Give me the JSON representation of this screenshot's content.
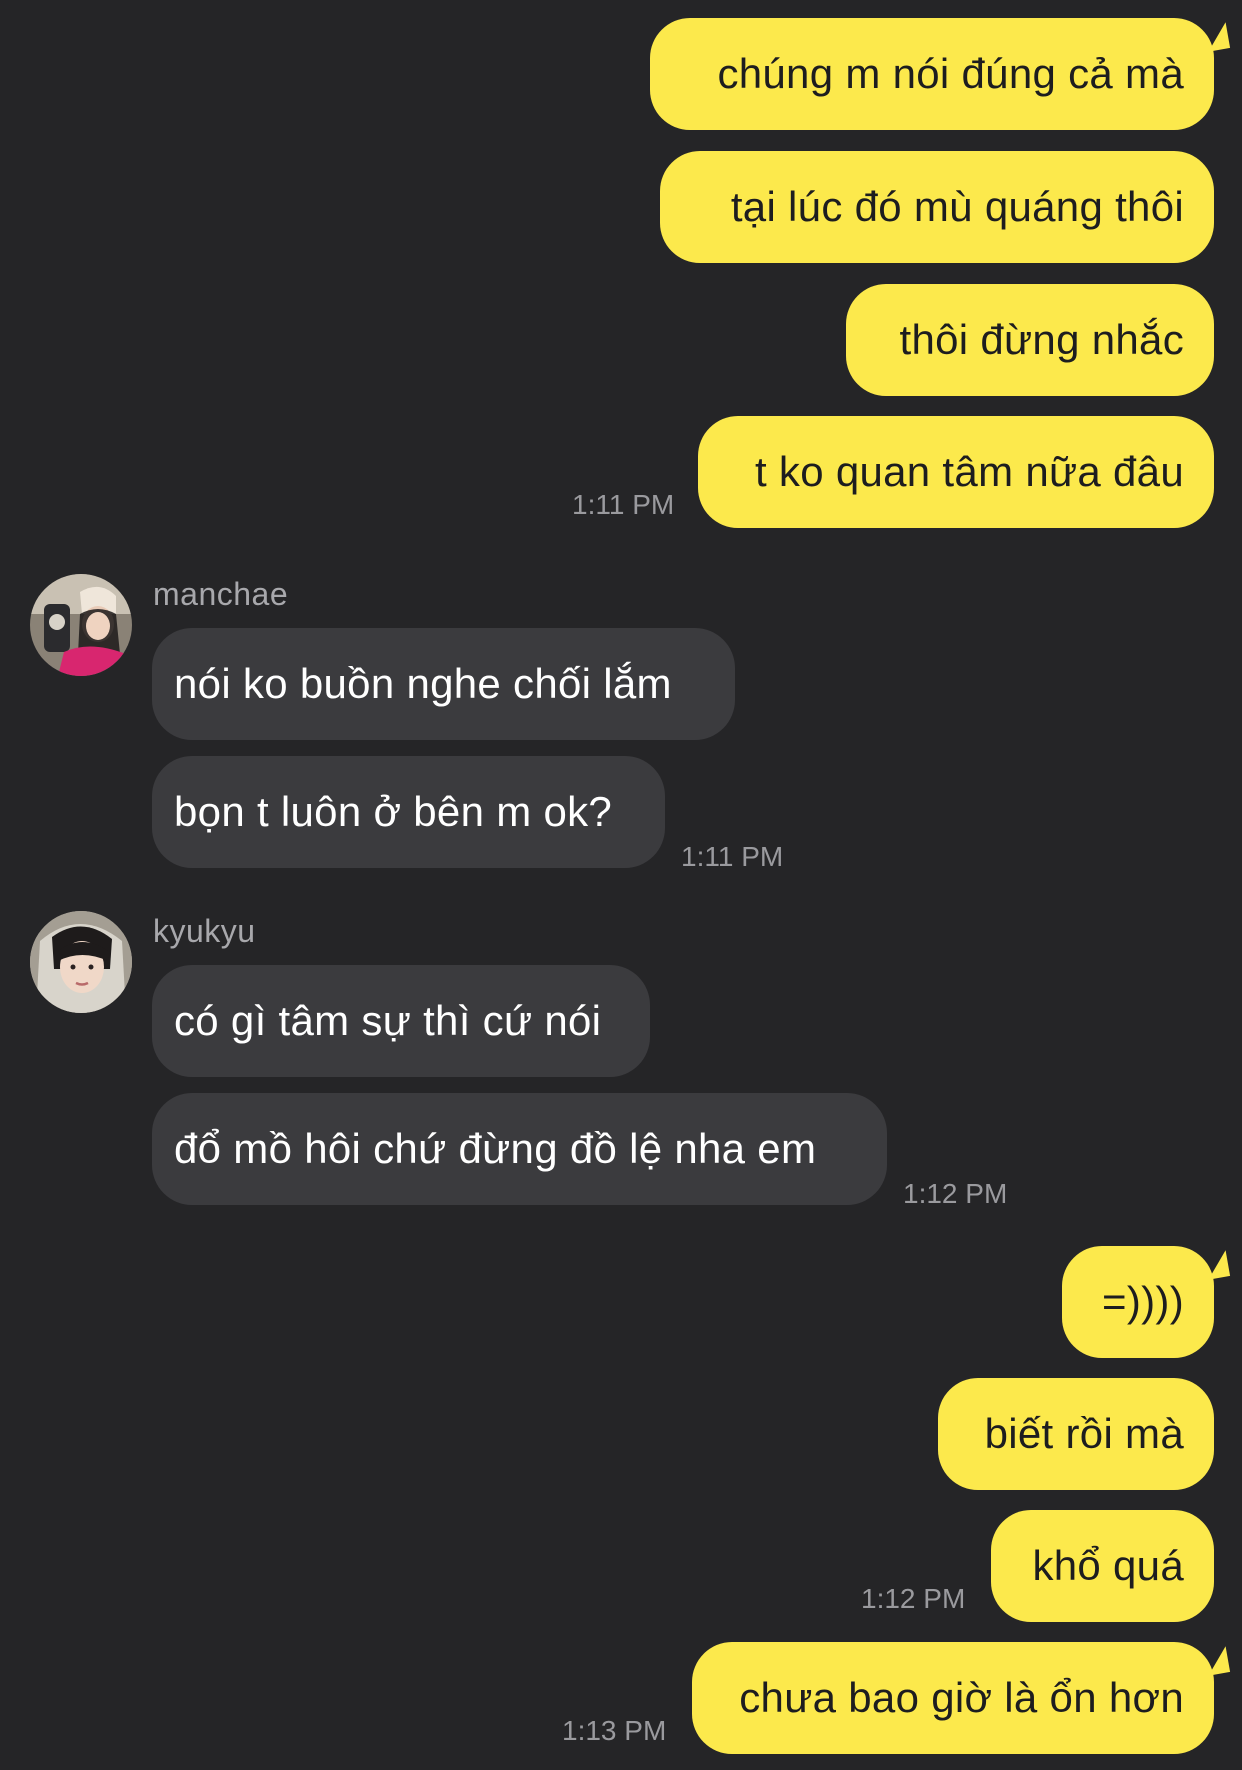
{
  "colors": {
    "background": "#252527",
    "outgoing_bubble": "#fce94c",
    "incoming_bubble": "#3b3b3e",
    "timestamp": "#9a9a9e",
    "sender_name": "#a8a8ac"
  },
  "messages": {
    "out1": {
      "texts": [
        "chúng m nói đúng cả mà",
        "tại lúc đó mù quáng thôi",
        "thôi đừng nhắc",
        "t ko quan tâm nữa đâu"
      ],
      "time": "1:11 PM"
    },
    "in1": {
      "sender": "manchae",
      "avatar": "manchae-avatar",
      "texts": [
        "nói ko buồn nghe chối lắm",
        "bọn t luôn ở bên m ok?"
      ],
      "time": "1:11 PM"
    },
    "in2": {
      "sender": "kyukyu",
      "avatar": "kyukyu-avatar",
      "texts": [
        "có gì tâm sự thì cứ nói",
        "đổ mồ hôi chứ đừng đồ lệ nha em"
      ],
      "time": "1:12 PM"
    },
    "out2": {
      "texts": [
        "=))))",
        "biết rồi mà",
        "khổ quá",
        "chưa bao giờ là ổn hơn"
      ],
      "time1": "1:12 PM",
      "time2": "1:13 PM"
    }
  }
}
